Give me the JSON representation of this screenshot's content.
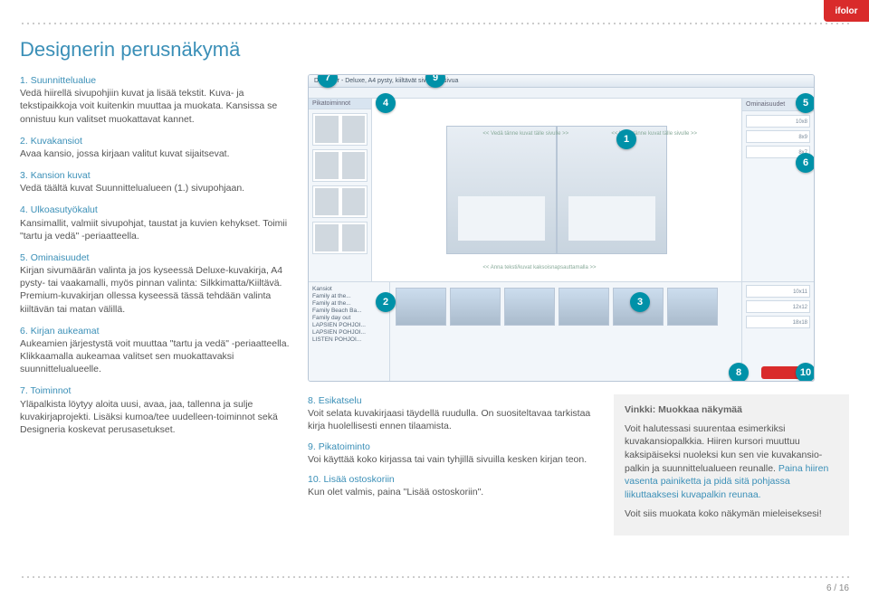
{
  "logo": "ifolor",
  "title": "Designerin perusnäkymä",
  "left_items": [
    {
      "n": "1.",
      "h": "Suunnittelualue",
      "t": "Vedä hiirellä sivupohjiin kuvat ja lisää tekstit. Kuva- ja tekstipaikkoja voit kuitenkin muuttaa ja muokata. Kansissa se onnistuu kun valitset muokattavat kannet."
    },
    {
      "n": "2.",
      "h": "Kuvakansiot",
      "t": "Avaa kansio, jossa kirjaan valitut kuvat sijaitsevat."
    },
    {
      "n": "3.",
      "h": "Kansion kuvat",
      "t": "Vedä täältä kuvat Suunnittelualueen (1.) sivupohjaan."
    },
    {
      "n": "4.",
      "h": "Ulkoasutyökalut",
      "t": "Kansimallit, valmiit sivupohjat, taustat ja kuvien kehykset. Toimii \"tartu ja vedä\" -periaatteella."
    },
    {
      "n": "5.",
      "h": "Ominaisuudet",
      "t": "Kirjan sivumäärän valinta ja jos kyseessä Deluxe-kuvakirja, A4 pysty- tai vaakamalli, myös pinnan valinta: Silkkimatta/Kiiltävä. Premium-kuvakirjan ollessa kyseessä tässä tehdään valinta kiiltävän tai matan välillä."
    },
    {
      "n": "6.",
      "h": "Kirjan aukeamat",
      "t": "Aukeamien järjestystä voit muuttaa \"tartu ja vedä\" -periaatteella. Klikkaamalla aukeamaa valitset sen muokattavaksi suunnittelualueelle."
    },
    {
      "n": "7.",
      "h": "Toiminnot",
      "t": "Yläpalkista löytyy aloita uusi, avaa, jaa, tallenna ja sulje kuvakirjaprojekti. Lisäksi kumoa/tee uudelleen-toiminnot sekä Designeria koskevat perusasetukset."
    }
  ],
  "below_items": [
    {
      "n": "8.",
      "h": "Esikatselu",
      "t": "Voit selata kuvakirjaasi täydellä ruudulla. On suositeltavaa tarkistaa kirja huolellisesti ennen tilaamista."
    },
    {
      "n": "9.",
      "h": "Pikatoiminto",
      "t": "Voi käyttää koko kirjassa tai vain tyhjillä sivuilla kesken kirjan teon."
    },
    {
      "n": "10.",
      "h": "Lisää ostoskoriin",
      "t": "Kun olet valmis, paina \"Lisää ostoskoriin\"."
    }
  ],
  "tip": {
    "title": "Vinkki: Muokkaa näkymää",
    "p1a": "Voit halutessasi suurentaa esimerkiksi kuvakansiopalkkia. Hiiren kursori muuttuu kaksipäiseksi nuoleksi kun sen vie kuvakansio­palkin ja suunnittelualueen reunalle. ",
    "p1b": "Paina hiiren vasenta painiketta ja pidä sitä pohjassa liikuttaaksesi kuvapalkin reunaa.",
    "p2": "Voit siis muokata koko näkymän mieleiseksesi!"
  },
  "shot": {
    "title": "Designer - Deluxe, A4 pysty, kiiltävät sivut, 84 sivua",
    "side_tab": "Pikatoiminnot",
    "hint1": "<< Vedä tänne kuvat tälle sivulle >>",
    "hint2": "<< Vedä tänne kuvat tälle sivulle >>",
    "hint3": "<< Anna teksti/kuvat kaksoisnapsauttamalla >>",
    "r_head": "Ominaisuudet",
    "sizes": [
      "10x8",
      "8x9",
      "8x7",
      "10x11",
      "12x12",
      "18x18"
    ],
    "tree": [
      "Kansiot",
      "Family at the...",
      "Family at the...",
      "Family Beach Ba...",
      "Family day out",
      "LAPSIEN POHJOI...",
      "LAPSIEN POHJOI...",
      "LISTEN POHJOI..."
    ]
  },
  "badges": {
    "b1": "1",
    "b2": "2",
    "b3": "3",
    "b4": "9",
    "b5": "5",
    "b6": "6",
    "b7": "7",
    "b8": "8",
    "b9": "4",
    "b10": "10"
  },
  "pager": "6 / 16"
}
